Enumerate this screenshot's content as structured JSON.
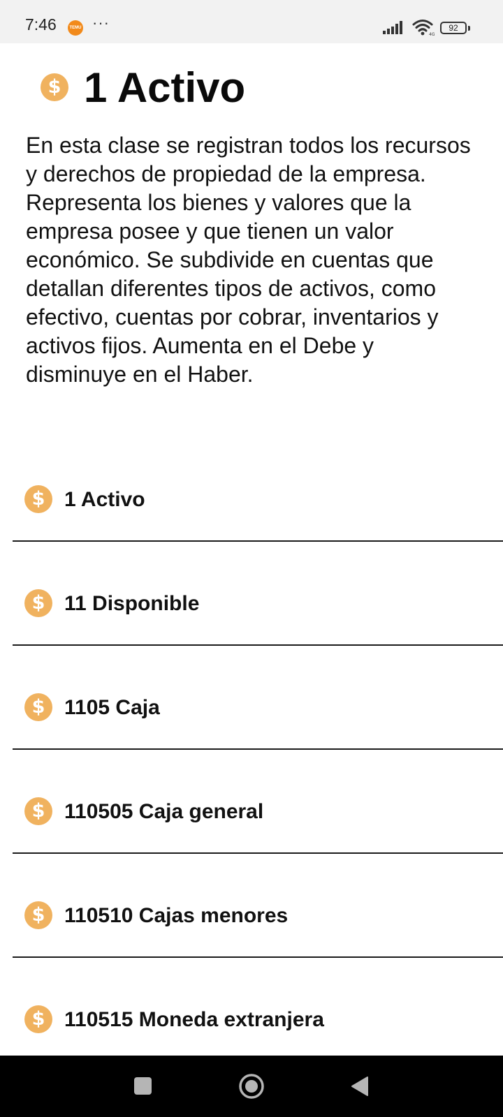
{
  "status_bar": {
    "time": "7:46",
    "app_icon_label": "TEMU",
    "more": "···",
    "battery": "92",
    "icons": [
      "signal-icon",
      "wifi-icon",
      "battery-icon"
    ]
  },
  "header": {
    "icon": "dollar-icon",
    "icon_glyph": "$",
    "title": "1 Activo",
    "description": "En esta clase se registran todos los recursos y derechos de propiedad de la empresa. Representa los bienes y valores que la empresa posee y que tienen un valor económico. Se subdivide en cuentas que detallan diferentes tipos de activos, como efectivo, cuentas por cobrar, inventarios y activos fijos. Aumenta en el Debe y disminuye en el Haber."
  },
  "accounts": [
    {
      "icon_glyph": "$",
      "label": "1 Activo"
    },
    {
      "icon_glyph": "$",
      "label": "11 Disponible"
    },
    {
      "icon_glyph": "$",
      "label": "1105 Caja"
    },
    {
      "icon_glyph": "$",
      "label": "110505 Caja general"
    },
    {
      "icon_glyph": "$",
      "label": "110510 Cajas menores"
    },
    {
      "icon_glyph": "$",
      "label": "110515 Moneda extranjera"
    }
  ],
  "colors": {
    "accent": "#f0b25f",
    "status_bar_bg": "#f2f2f2",
    "nav_bar_bg": "#000000",
    "divider": "#1a1a1a"
  },
  "nav_bar": {
    "icons": [
      "recents-icon",
      "home-icon",
      "back-icon"
    ]
  }
}
